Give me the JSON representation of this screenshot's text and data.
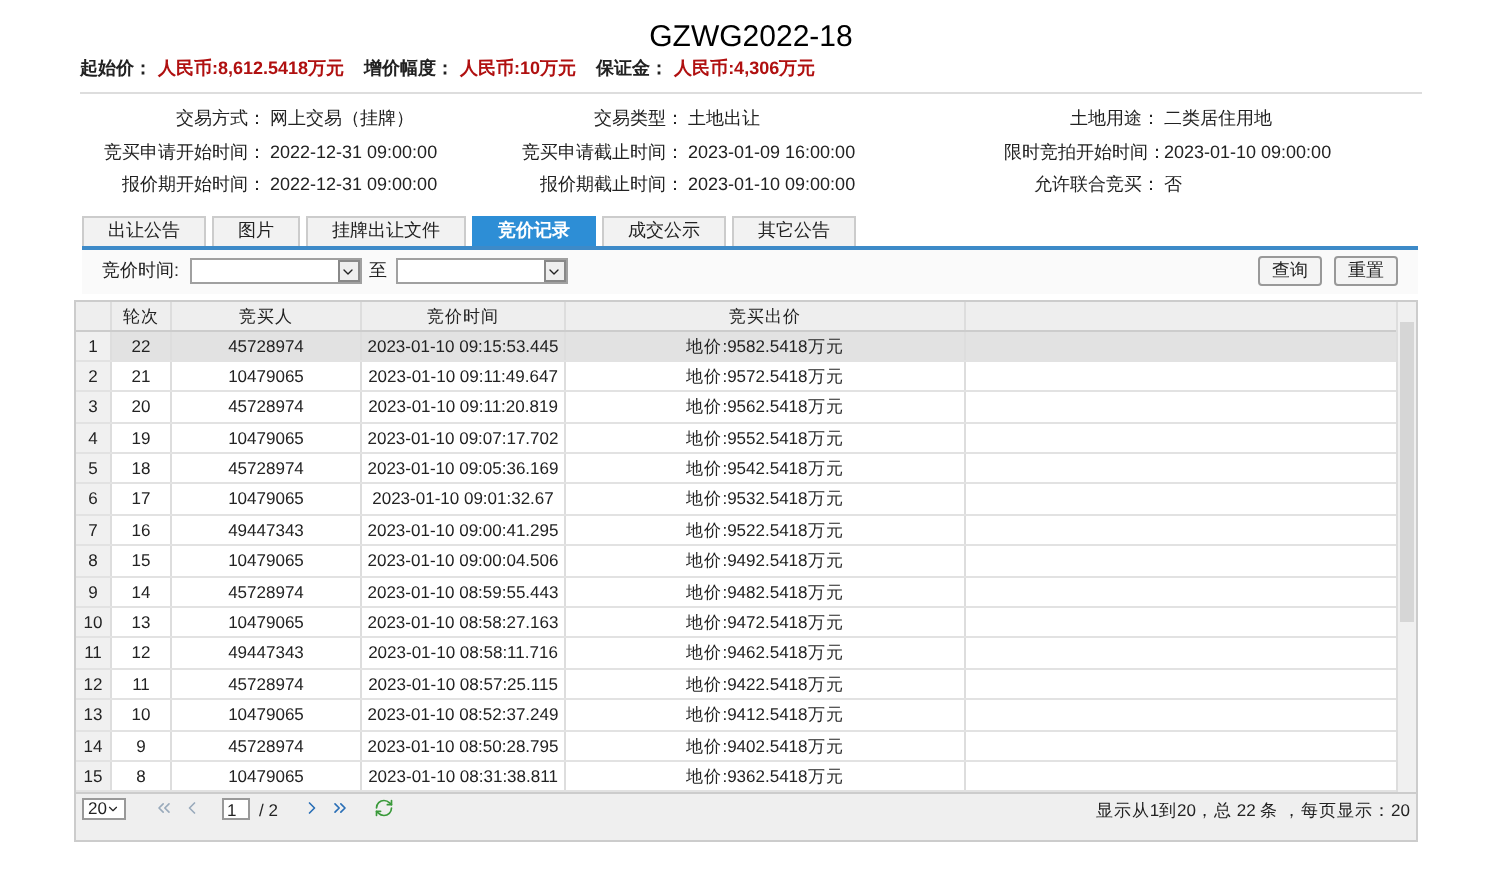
{
  "title": "GZWG2022-18",
  "prices": [
    {
      "label": "起始价：",
      "value": "人民币:8,612.5418万元"
    },
    {
      "label": "增价幅度：",
      "value": "人民币:10万元"
    },
    {
      "label": "保证金：",
      "value": "人民币:4,306万元"
    }
  ],
  "info": [
    {
      "label": "交易方式：",
      "value": "网上交易（挂牌）"
    },
    {
      "label": "交易类型：",
      "value": "土地出让"
    },
    {
      "label": "土地用途：",
      "value": "二类居住用地"
    },
    {
      "label": "竞买申请开始时间：",
      "value": "2022-12-31 09:00:00"
    },
    {
      "label": "竞买申请截止时间：",
      "value": "2023-01-09 16:00:00"
    },
    {
      "label": "限时竞拍开始时间：",
      "value": "2023-01-10 09:00:00"
    },
    {
      "label": "报价期开始时间：",
      "value": "2022-12-31 09:00:00"
    },
    {
      "label": "报价期截止时间：",
      "value": "2023-01-10 09:00:00"
    },
    {
      "label": "允许联合竞买：",
      "value": "否"
    }
  ],
  "tabs": [
    {
      "label": "出让公告",
      "selected": false
    },
    {
      "label": "图片",
      "selected": false
    },
    {
      "label": "挂牌出让文件",
      "selected": false
    },
    {
      "label": "竞价记录",
      "selected": true
    },
    {
      "label": "成交公示",
      "selected": false
    },
    {
      "label": "其它公告",
      "selected": false
    }
  ],
  "filter": {
    "label": "竞价时间:",
    "between": "至",
    "buttons": [
      "查询",
      "重置"
    ]
  },
  "table": {
    "columns": [
      "轮次",
      "竞买人",
      "竞价时间",
      "竞买出价"
    ],
    "rows": [
      {
        "index": "1",
        "cells": [
          "22",
          "45728974",
          "2023-01-10 09:15:53.445",
          "地价:9582.5418万元"
        ],
        "selected": true
      },
      {
        "index": "2",
        "cells": [
          "21",
          "10479065",
          "2023-01-10 09:11:49.647",
          "地价:9572.5418万元"
        ],
        "selected": false
      },
      {
        "index": "3",
        "cells": [
          "20",
          "45728974",
          "2023-01-10 09:11:20.819",
          "地价:9562.5418万元"
        ],
        "selected": false
      },
      {
        "index": "4",
        "cells": [
          "19",
          "10479065",
          "2023-01-10 09:07:17.702",
          "地价:9552.5418万元"
        ],
        "selected": false
      },
      {
        "index": "5",
        "cells": [
          "18",
          "45728974",
          "2023-01-10 09:05:36.169",
          "地价:9542.5418万元"
        ],
        "selected": false
      },
      {
        "index": "6",
        "cells": [
          "17",
          "10479065",
          "2023-01-10 09:01:32.67",
          "地价:9532.5418万元"
        ],
        "selected": false
      },
      {
        "index": "7",
        "cells": [
          "16",
          "49447343",
          "2023-01-10 09:00:41.295",
          "地价:9522.5418万元"
        ],
        "selected": false
      },
      {
        "index": "8",
        "cells": [
          "15",
          "10479065",
          "2023-01-10 09:00:04.506",
          "地价:9492.5418万元"
        ],
        "selected": false
      },
      {
        "index": "9",
        "cells": [
          "14",
          "45728974",
          "2023-01-10 08:59:55.443",
          "地价:9482.5418万元"
        ],
        "selected": false
      },
      {
        "index": "10",
        "cells": [
          "13",
          "10479065",
          "2023-01-10 08:58:27.163",
          "地价:9472.5418万元"
        ],
        "selected": false
      },
      {
        "index": "11",
        "cells": [
          "12",
          "49447343",
          "2023-01-10 08:58:11.716",
          "地价:9462.5418万元"
        ],
        "selected": false
      },
      {
        "index": "12",
        "cells": [
          "11",
          "45728974",
          "2023-01-10 08:57:25.115",
          "地价:9422.5418万元"
        ],
        "selected": false
      },
      {
        "index": "13",
        "cells": [
          "10",
          "10479065",
          "2023-01-10 08:52:37.249",
          "地价:9412.5418万元"
        ],
        "selected": false
      },
      {
        "index": "14",
        "cells": [
          "9",
          "45728974",
          "2023-01-10 08:50:28.795",
          "地价:9402.5418万元"
        ],
        "selected": false
      },
      {
        "index": "15",
        "cells": [
          "8",
          "10479065",
          "2023-01-10 08:31:38.811",
          "地价:9362.5418万元"
        ],
        "selected": false
      }
    ]
  },
  "pager": {
    "page_size": "20",
    "page": "1",
    "pages": "/ 2",
    "summary": "显示从1到20，总 22 条 ，每页显示：20"
  }
}
